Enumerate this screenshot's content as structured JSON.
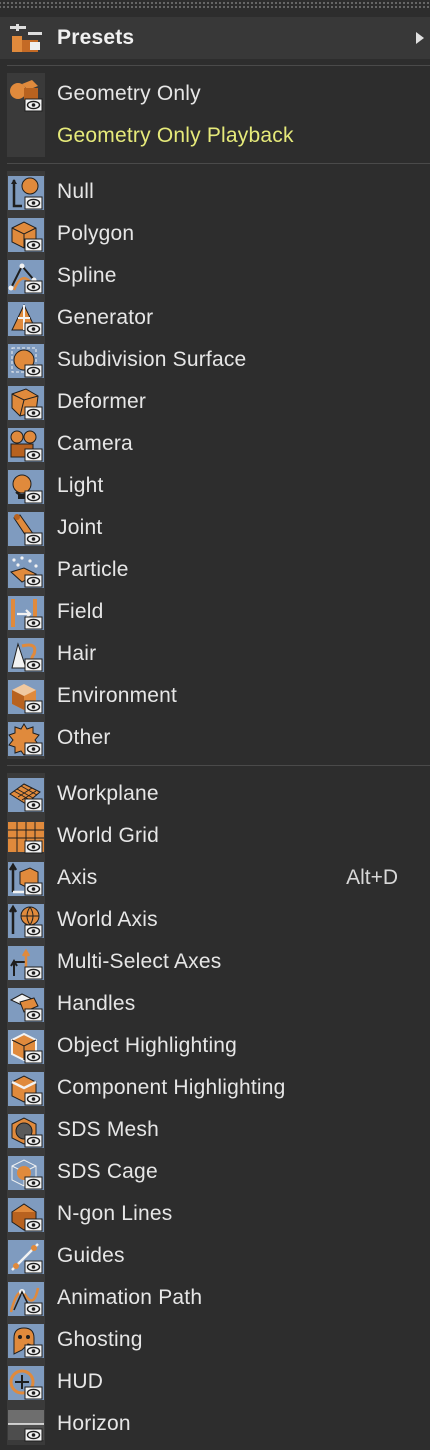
{
  "menu": {
    "header": {
      "label": "Presets",
      "icon": "presets-icon"
    },
    "group1": [
      {
        "label": "Geometry Only",
        "icon": "geometry-only-icon"
      },
      {
        "label": "Geometry Only Playback",
        "icon": "none"
      }
    ],
    "group2": [
      {
        "label": "Null",
        "icon": "null-icon"
      },
      {
        "label": "Polygon",
        "icon": "polygon-icon"
      },
      {
        "label": "Spline",
        "icon": "spline-icon"
      },
      {
        "label": "Generator",
        "icon": "generator-icon"
      },
      {
        "label": "Subdivision Surface",
        "icon": "subdivision-surface-icon"
      },
      {
        "label": "Deformer",
        "icon": "deformer-icon"
      },
      {
        "label": "Camera",
        "icon": "camera-icon"
      },
      {
        "label": "Light",
        "icon": "light-icon"
      },
      {
        "label": "Joint",
        "icon": "joint-icon"
      },
      {
        "label": "Particle",
        "icon": "particle-icon"
      },
      {
        "label": "Field",
        "icon": "field-icon"
      },
      {
        "label": "Hair",
        "icon": "hair-icon"
      },
      {
        "label": "Environment",
        "icon": "environment-icon"
      },
      {
        "label": "Other",
        "icon": "other-icon"
      }
    ],
    "group3": [
      {
        "label": "Workplane",
        "icon": "workplane-icon"
      },
      {
        "label": "World Grid",
        "icon": "world-grid-icon"
      },
      {
        "label": "Axis",
        "icon": "axis-icon",
        "shortcut": "Alt+D"
      },
      {
        "label": "World Axis",
        "icon": "world-axis-icon"
      },
      {
        "label": "Multi-Select Axes",
        "icon": "multi-select-axes-icon"
      },
      {
        "label": "Handles",
        "icon": "handles-icon"
      },
      {
        "label": "Object Highlighting",
        "icon": "object-highlighting-icon"
      },
      {
        "label": "Component Highlighting",
        "icon": "component-highlighting-icon"
      },
      {
        "label": "SDS Mesh",
        "icon": "sds-mesh-icon"
      },
      {
        "label": "SDS Cage",
        "icon": "sds-cage-icon"
      },
      {
        "label": "N-gon Lines",
        "icon": "ngon-lines-icon"
      },
      {
        "label": "Guides",
        "icon": "guides-icon"
      },
      {
        "label": "Animation Path",
        "icon": "animation-path-icon"
      },
      {
        "label": "Ghosting",
        "icon": "ghosting-icon"
      },
      {
        "label": "HUD",
        "icon": "hud-icon"
      },
      {
        "label": "Horizon",
        "icon": "horizon-icon"
      }
    ]
  },
  "colors": {
    "background": "#2d2d2d",
    "icon_orange": "#e08a3c",
    "icon_blue": "#7f9bbf",
    "highlight_text": "#e6ea7a"
  }
}
